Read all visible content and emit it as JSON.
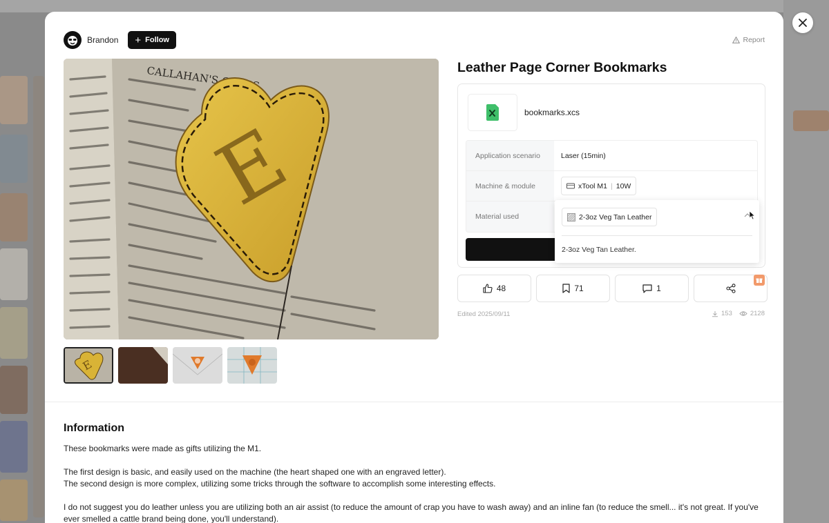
{
  "author": {
    "name": "Brandon",
    "follow_label": "Follow"
  },
  "report_label": "Report",
  "project": {
    "title": "Leather Page Corner Bookmarks",
    "file_name": "bookmarks.xcs",
    "specs": [
      {
        "label": "Application scenario",
        "value": "Laser (15min)"
      },
      {
        "label": "Machine & module",
        "machine": "xTool M1",
        "module": "10W"
      },
      {
        "label": "Material used"
      }
    ],
    "material_dropdown": {
      "selected": "2-3oz Veg Tan Leather",
      "description": "2-3oz Veg Tan Leather."
    }
  },
  "actions": {
    "likes": "48",
    "bookmarks": "71",
    "comments": "1"
  },
  "meta": {
    "edited": "Edited 2025/09/11",
    "downloads": "153",
    "views": "2128"
  },
  "information": {
    "heading": "Information",
    "p1": "These bookmarks were made as gifts utilizing the M1.",
    "p2a": "The first design is basic, and easily used on the machine (the heart shaped one with an engraved letter).",
    "p2b": "The second design is more complex, utilizing some tricks through the software to accomplish some interesting effects.",
    "p3": "I do not suggest you do leather unless you are utilizing both an air assist (to reduce the amount of crap you have to wash away) and an inline fan (to reduce the smell... it's not great. If you've ever smelled a cattle brand being done, you'll understand)."
  },
  "image_text": {
    "book_header": "CALLAHAN'S CROSS",
    "letter": "E"
  },
  "colors": {
    "accent_black": "#111111",
    "file_icon_green": "#3fbf6a",
    "gift_orange": "#f29a6b",
    "leather_yellow": "#d9b336"
  }
}
